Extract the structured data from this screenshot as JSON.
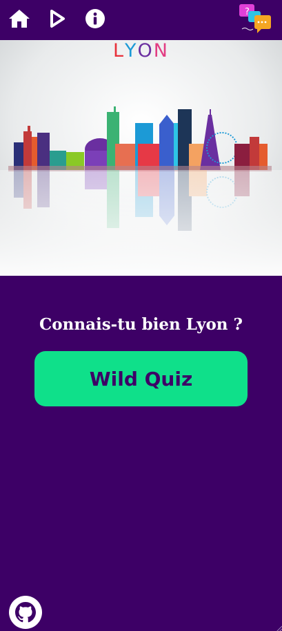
{
  "nav": {
    "home_icon": "home-icon",
    "play_icon": "play-icon",
    "info_icon": "info-icon",
    "logo_icon": "chat-bubbles-logo"
  },
  "banner": {
    "city_label": "LYON",
    "letters": [
      "L",
      "Y",
      "O",
      "N"
    ],
    "letter_colors": [
      "#e8303a",
      "#1c9ad6",
      "#6a2fa0",
      "#e23d83"
    ]
  },
  "main": {
    "headline": "Connais-tu bien Lyon ?",
    "quiz_button_label": "Wild Quiz"
  },
  "footer": {
    "github_icon": "github-icon"
  },
  "colors": {
    "background": "#3d0066",
    "button": "#0fe08a",
    "button_text": "#3d0066",
    "headline_text": "#ffffff"
  }
}
